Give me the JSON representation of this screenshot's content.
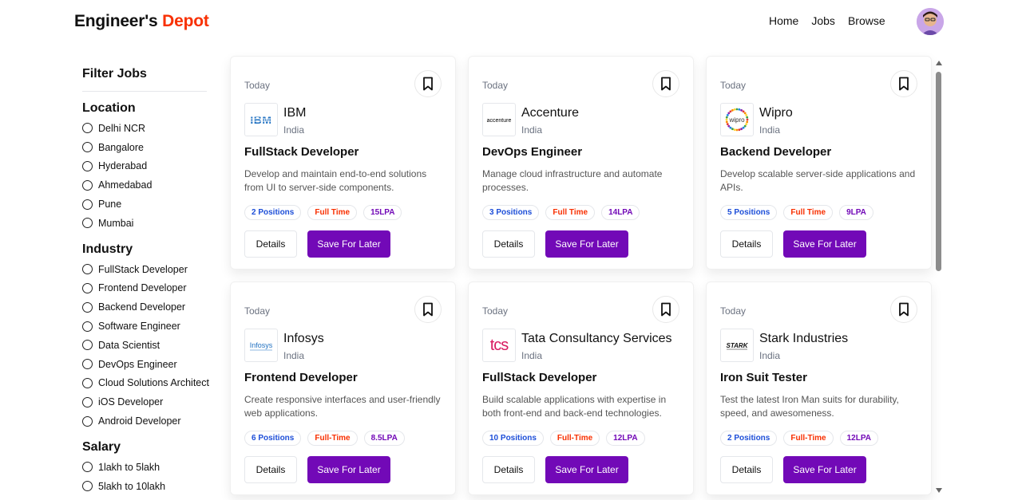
{
  "brand": {
    "prefix": "Engineer's ",
    "accent": "Depot"
  },
  "nav": {
    "links": [
      "Home",
      "Jobs",
      "Browse"
    ]
  },
  "sidebar": {
    "title": "Filter Jobs",
    "groups": [
      {
        "title": "Location",
        "options": [
          "Delhi NCR",
          "Bangalore",
          "Hyderabad",
          "Ahmedabad",
          "Pune",
          "Mumbai"
        ]
      },
      {
        "title": "Industry",
        "options": [
          "FullStack Developer",
          "Frontend Developer",
          "Backend Developer",
          "Software Engineer",
          "Data Scientist",
          "DevOps Engineer",
          "Cloud Solutions Architect",
          "iOS Developer",
          "Android Developer"
        ]
      },
      {
        "title": "Salary",
        "options": [
          "1lakh to 5lakh",
          "5lakh to 10lakh"
        ]
      }
    ]
  },
  "jobs": [
    {
      "date": "Today",
      "company": "IBM",
      "country": "India",
      "title": "FullStack Developer",
      "description": "Develop and maintain end-to-end solutions from UI to server-side components.",
      "positions": "2 Positions",
      "type": "Full Time",
      "salary": "15LPA",
      "logo": "IBM"
    },
    {
      "date": "Today",
      "company": "Accenture",
      "country": "India",
      "title": "DevOps Engineer",
      "description": "Manage cloud infrastructure and automate processes.",
      "positions": "3 Positions",
      "type": "Full Time",
      "salary": "14LPA",
      "logo": "accenture"
    },
    {
      "date": "Today",
      "company": "Wipro",
      "country": "India",
      "title": "Backend Developer",
      "description": "Develop scalable server-side applications and APIs.",
      "positions": "5 Positions",
      "type": "Full Time",
      "salary": "9LPA",
      "logo": "wipro"
    },
    {
      "date": "Today",
      "company": "Infosys",
      "country": "India",
      "title": "Frontend Developer",
      "description": "Create responsive interfaces and user-friendly web applications.",
      "positions": "6 Positions",
      "type": "Full-Time",
      "salary": "8.5LPA",
      "logo": "Infosys"
    },
    {
      "date": "Today",
      "company": "Tata Consultancy Services",
      "country": "India",
      "title": "FullStack Developer",
      "description": "Build scalable applications with expertise in both front-end and back-end technologies.",
      "positions": "10 Positions",
      "type": "Full-Time",
      "salary": "12LPA",
      "logo": "tcs"
    },
    {
      "date": "Today",
      "company": "Stark Industries",
      "country": "India",
      "title": "Iron Suit Tester",
      "description": "Test the latest Iron Man suits for durability, speed, and awesomeness.",
      "positions": "2 Positions",
      "type": "Full-Time",
      "salary": "12LPA",
      "logo": "STARK"
    }
  ],
  "buttons": {
    "details": "Details",
    "save": "Save For Later"
  },
  "colors": {
    "accent": "#F83002",
    "primary": "#7209b7",
    "positions": "#1d4ed8"
  }
}
